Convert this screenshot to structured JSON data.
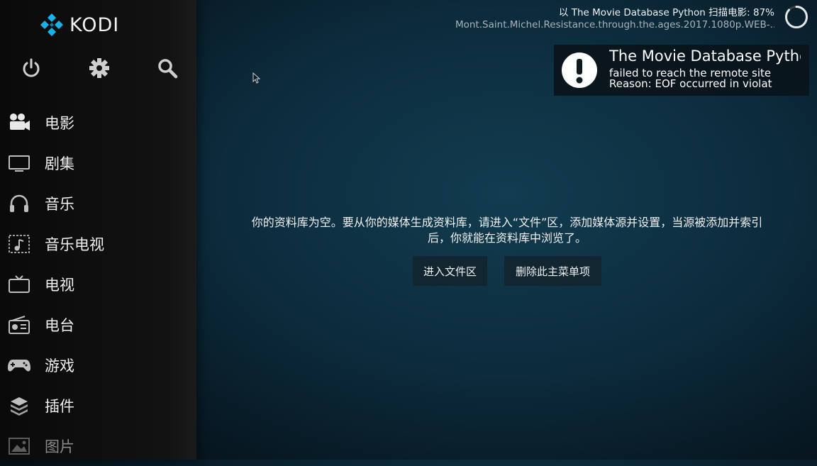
{
  "app": {
    "logo_text": "KODI"
  },
  "top_icons": [
    "power-icon",
    "gear-icon",
    "search-icon"
  ],
  "menu": [
    {
      "label": "电影",
      "icon": "movie-camera-icon"
    },
    {
      "label": "剧集",
      "icon": "tv-monitor-icon"
    },
    {
      "label": "音乐",
      "icon": "headphones-icon"
    },
    {
      "label": "音乐电视",
      "icon": "music-video-icon"
    },
    {
      "label": "电视",
      "icon": "television-icon"
    },
    {
      "label": "电台",
      "icon": "radio-icon"
    },
    {
      "label": "游戏",
      "icon": "gamepad-icon"
    },
    {
      "label": "插件",
      "icon": "addons-box-icon"
    },
    {
      "label": "图片",
      "icon": "picture-icon"
    }
  ],
  "scan": {
    "line1": "以 The Movie Database Python 扫描电影: 87%",
    "line2": "Mont.Saint.Michel.Resistance.through.the.ages.2017.1080p.WEB-...",
    "progress_percent": 87
  },
  "toast": {
    "icon": "warning-exclamation-icon",
    "title": "The Movie Database Python",
    "line1": "failed to reach the remote site",
    "line2": "Reason: EOF occurred in violat"
  },
  "main": {
    "message_line1": "你的资料库为空。要从你的媒体生成资料库，请进入“文件”区，添加媒体源并设置，当源被添加并索引",
    "message_line2": "后，你就能在资料库中浏览了。",
    "btn_files": "进入文件区",
    "btn_remove": "删除此主菜单项"
  },
  "colors": {
    "background": "#0c2c3d",
    "sidebar": "#121212",
    "button": "#112630",
    "logo_blue": "#17b2e7"
  }
}
